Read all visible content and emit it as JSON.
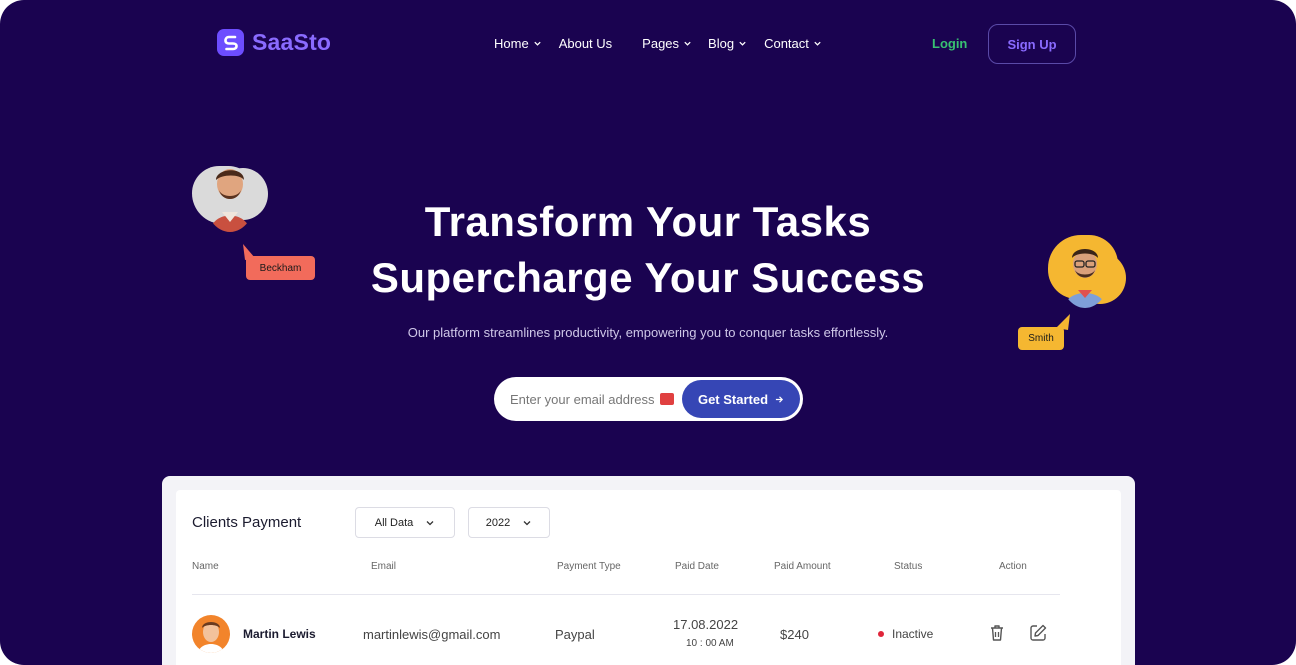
{
  "brand": {
    "name": "SaaSto",
    "accent": "#6d4dff",
    "background": "#1a0350"
  },
  "nav": {
    "items": [
      {
        "label": "Home",
        "dropdown": true
      },
      {
        "label": "About Us",
        "dropdown": false
      },
      {
        "label": "Pages",
        "dropdown": true
      },
      {
        "label": "Blog",
        "dropdown": true
      },
      {
        "label": "Contact",
        "dropdown": true
      }
    ],
    "login": "Login",
    "signup": "Sign Up"
  },
  "hero": {
    "title_line1": "Transform Your Tasks",
    "title_line2": "Supercharge Your Success",
    "subtitle": "Our platform streamlines productivity, empowering you to conquer tasks effortlessly.",
    "email_placeholder": "Enter your email address",
    "cta": "Get Started"
  },
  "avatars": [
    {
      "name": "Beckham",
      "tag_color": "#f26b5b",
      "blob_color": "#d8d8d8"
    },
    {
      "name": "Smith",
      "tag_color": "#f5b731",
      "blob_color": "#f5b731"
    }
  ],
  "table": {
    "title": "Clients Payment",
    "filter_data": "All Data",
    "filter_year": "2022",
    "columns": [
      "Name",
      "Email",
      "Payment Type",
      "Paid Date",
      "Paid Amount",
      "Status",
      "Action"
    ],
    "rows": [
      {
        "name": "Martin Lewis",
        "email": "martinlewis@gmail.com",
        "payment_type": "Paypal",
        "paid_date": "17.08.2022",
        "paid_time": "10 : 00 AM",
        "amount": "$240",
        "status": "Inactive",
        "status_color": "#e0253a",
        "actions": [
          "trash-icon",
          "edit-icon"
        ]
      }
    ]
  }
}
